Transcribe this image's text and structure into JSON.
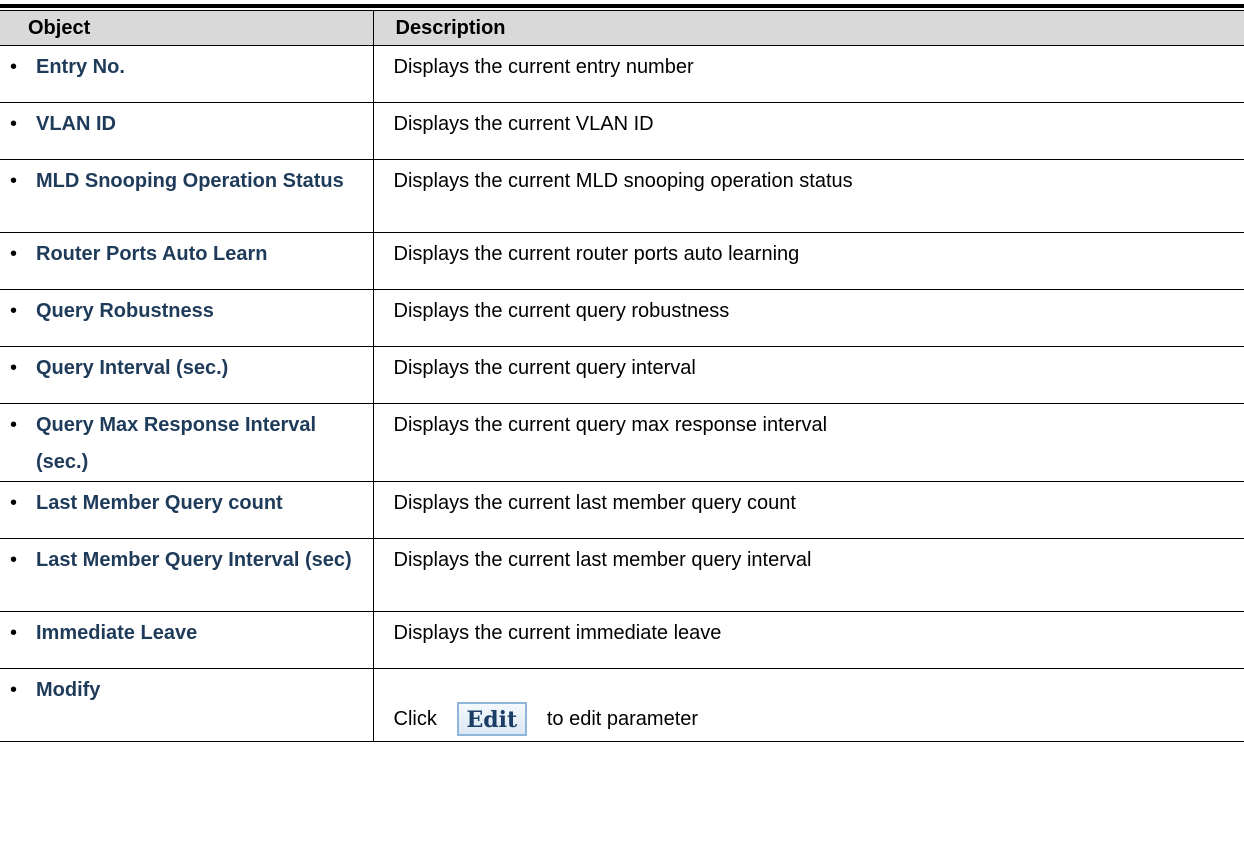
{
  "table": {
    "headers": {
      "object": "Object",
      "description": "Description"
    },
    "rows": [
      {
        "object": "Entry No.",
        "description": "Displays the current entry number"
      },
      {
        "object": "VLAN ID",
        "description": "Displays the current VLAN ID"
      },
      {
        "object": "MLD Snooping Operation Status",
        "description": "Displays the current MLD snooping operation status"
      },
      {
        "object": "Router Ports Auto Learn",
        "description": "Displays the current router ports auto learning"
      },
      {
        "object": "Query Robustness",
        "description": "Displays the current query robustness"
      },
      {
        "object": "Query Interval (sec.)",
        "description": "Displays the current query interval"
      },
      {
        "object": "Query Max Response Interval (sec.)",
        "description": "Displays the current query max response interval"
      },
      {
        "object": "Last Member Query count",
        "description": "Displays the current last member query count"
      },
      {
        "object": "Last Member Query Interval (sec)",
        "description": "Displays the current last member query interval"
      },
      {
        "object": "Immediate Leave",
        "description": "Displays the current immediate leave"
      },
      {
        "object": "Modify",
        "description_prefix": "Click",
        "button_label": "Edit",
        "description_suffix": "to edit parameter"
      }
    ]
  },
  "colors": {
    "header_bg": "#d9d9d9",
    "object_text": "#1f3b5a",
    "button_border": "#8fb6d8"
  }
}
